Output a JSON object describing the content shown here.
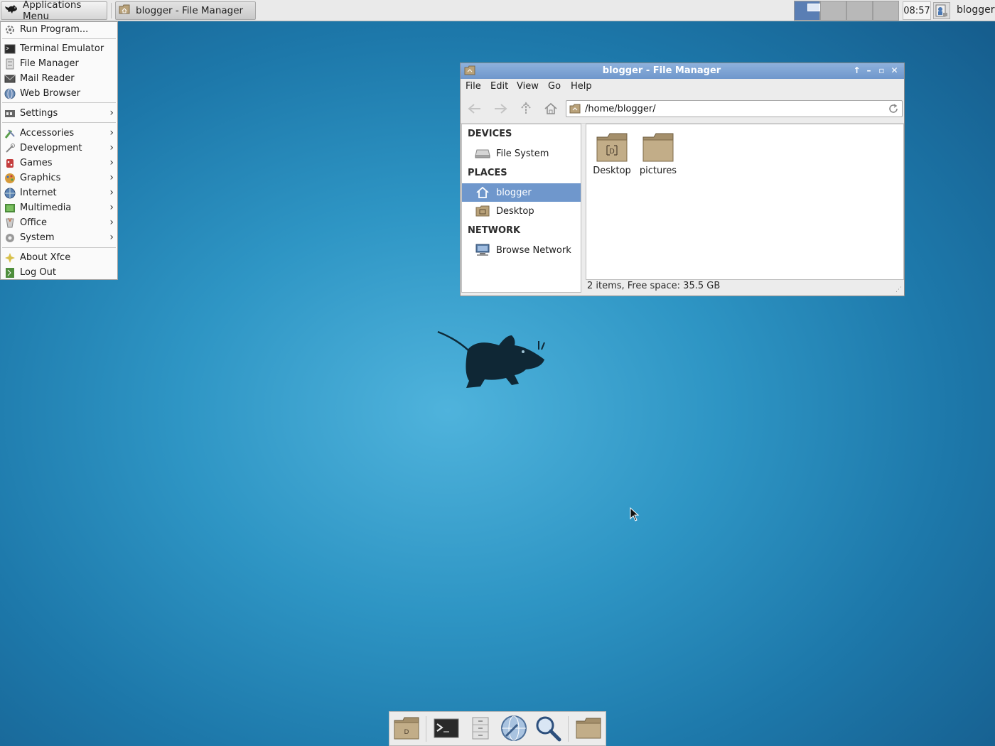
{
  "top_panel": {
    "applications_menu_label": "Applications Menu",
    "task_file_manager_label": "blogger - File Manager",
    "clock": "08:57",
    "user": "blogger"
  },
  "app_menu": {
    "items": [
      {
        "label": "Run Program...",
        "icon": "run-program-icon"
      },
      {
        "label": "Terminal Emulator",
        "icon": "terminal-icon"
      },
      {
        "label": "File Manager",
        "icon": "file-manager-icon"
      },
      {
        "label": "Mail Reader",
        "icon": "mail-icon"
      },
      {
        "label": "Web Browser",
        "icon": "web-browser-icon"
      },
      {
        "label": "Settings",
        "icon": "settings-icon",
        "submenu": true
      },
      {
        "label": "Accessories",
        "icon": "accessories-icon",
        "submenu": true
      },
      {
        "label": "Development",
        "icon": "development-icon",
        "submenu": true
      },
      {
        "label": "Games",
        "icon": "games-icon",
        "submenu": true
      },
      {
        "label": "Graphics",
        "icon": "graphics-icon",
        "submenu": true
      },
      {
        "label": "Internet",
        "icon": "internet-icon",
        "submenu": true
      },
      {
        "label": "Multimedia",
        "icon": "multimedia-icon",
        "submenu": true
      },
      {
        "label": "Office",
        "icon": "office-icon",
        "submenu": true
      },
      {
        "label": "System",
        "icon": "system-icon",
        "submenu": true
      },
      {
        "label": "About Xfce",
        "icon": "about-icon"
      },
      {
        "label": "Log Out",
        "icon": "logout-icon"
      }
    ]
  },
  "file_manager": {
    "title": "blogger - File Manager",
    "menus": [
      "File",
      "Edit",
      "View",
      "Go",
      "Help"
    ],
    "location": "/home/blogger/",
    "side_pane": {
      "devices_heading": "DEVICES",
      "places_heading": "PLACES",
      "network_heading": "NETWORK",
      "file_system": "File System",
      "home": "blogger",
      "desktop": "Desktop",
      "browse_network": "Browse Network"
    },
    "files": [
      {
        "name": "Desktop",
        "icon": "desktop-folder-icon"
      },
      {
        "name": "pictures",
        "icon": "folder-icon"
      }
    ],
    "status": "2 items, Free space: 35.5 GB"
  },
  "colors": {
    "selection": "#6f97cc",
    "titlebar": "#7ca2d4",
    "desktop": "#2e95c4"
  }
}
